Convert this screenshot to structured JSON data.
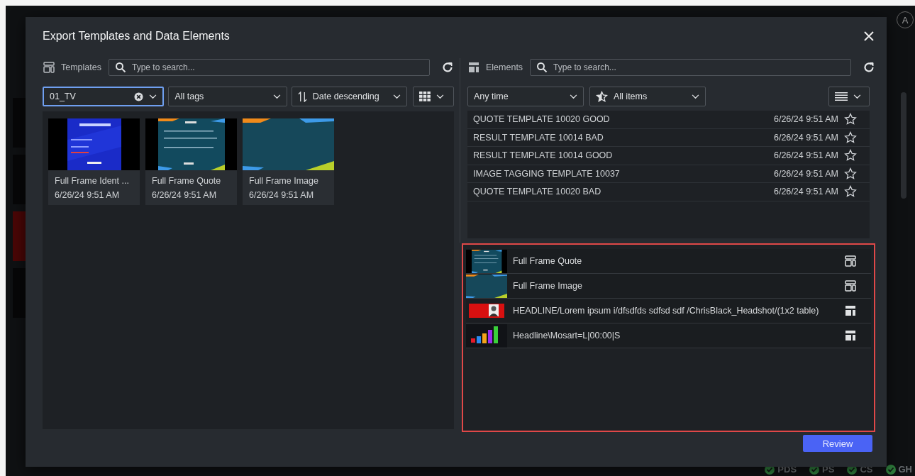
{
  "app": {
    "avatar": "A",
    "status_bar": [
      {
        "label": "PDS",
        "ok": true
      },
      {
        "label": "PS",
        "ok": true
      },
      {
        "label": "CS",
        "ok": true
      },
      {
        "label": "GH",
        "ok": true
      }
    ]
  },
  "dialog": {
    "title": "Export Templates and Data Elements",
    "templates": {
      "label": "Templates",
      "search": {
        "placeholder": "Type to search..."
      },
      "filters": [
        {
          "kind": "dropdown",
          "value": "01_TV",
          "clearable": true,
          "focused": true
        },
        {
          "kind": "dropdown",
          "value": "All tags",
          "clearable": false,
          "focused": false
        },
        {
          "kind": "sort",
          "value": "Date descending",
          "clearable": false,
          "focused": false
        },
        {
          "kind": "view",
          "clearable": false,
          "focused": false
        }
      ],
      "cards": [
        {
          "name": "Full Frame Ident ...",
          "date": "6/26/24 9:51 AM"
        },
        {
          "name": "Full Frame Quote",
          "date": "6/26/24 9:51 AM"
        },
        {
          "name": "Full Frame Image",
          "date": "6/26/24 9:51 AM"
        }
      ]
    },
    "elements": {
      "label": "Elements",
      "search": {
        "placeholder": "Type to search..."
      },
      "filters": [
        {
          "kind": "dropdown",
          "value": "Any time"
        },
        {
          "kind": "starred",
          "value": "All items"
        },
        {
          "kind": "list-view"
        }
      ],
      "rows": [
        {
          "name": "QUOTE TEMPLATE 10020 GOOD",
          "date": "6/26/24 9:51 AM",
          "starred": false
        },
        {
          "name": "RESULT TEMPLATE 10014 BAD",
          "date": "6/26/24 9:51 AM",
          "starred": false
        },
        {
          "name": "RESULT TEMPLATE 10014 GOOD",
          "date": "6/26/24 9:51 AM",
          "starred": false
        },
        {
          "name": "IMAGE TAGGING TEMPLATE 10037",
          "date": "6/26/24 9:51 AM",
          "starred": false
        },
        {
          "name": "QUOTE TEMPLATE 10020 BAD",
          "date": "6/26/24 9:51 AM",
          "starred": false
        }
      ]
    },
    "selection": [
      {
        "name": "Full Frame Quote",
        "kind": "template"
      },
      {
        "name": "Full Frame Image",
        "kind": "template"
      },
      {
        "name": "HEADLINE/Lorem ipsum i/dfsdfds sdfsd sdf /ChrisBlack_Headshot/(1x2 table)",
        "kind": "element"
      },
      {
        "name": "Headline\\Mosart=L|00:00|S",
        "kind": "element"
      }
    ],
    "buttons": [
      {
        "label": "Review"
      }
    ]
  }
}
